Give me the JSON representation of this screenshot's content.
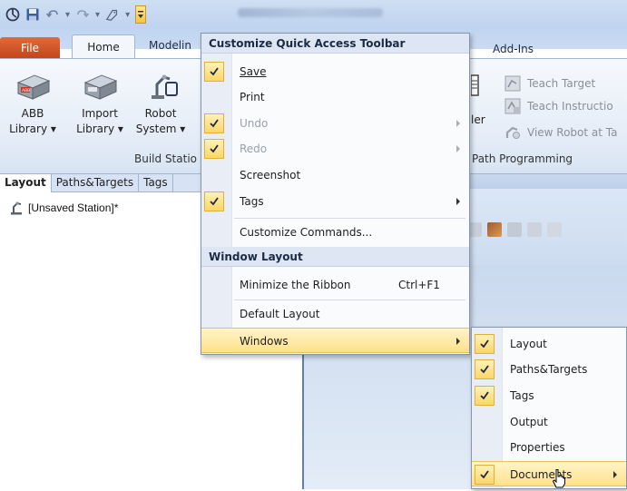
{
  "ribbon": {
    "tabs": {
      "file": "File",
      "home": "Home",
      "modeling": "Modelin",
      "addins": "Add-Ins"
    },
    "buttons": [
      {
        "line1": "ABB",
        "line2": "Library ▾"
      },
      {
        "line1": "Import",
        "line2": "Library ▾"
      },
      {
        "line1": "Robot",
        "line2": "System ▾"
      }
    ],
    "group_build": "Build Statio",
    "group_path": "Path Programming",
    "partial_label": "ler",
    "small_buttons": [
      "Teach Target",
      "Teach Instructio",
      "View Robot at Ta"
    ]
  },
  "panel": {
    "tabs": [
      "Layout",
      "Paths&Targets",
      "Tags"
    ],
    "tree_item": "[Unsaved Station]*"
  },
  "qat_menu": {
    "header1": "Customize Quick Access Toolbar",
    "header2": "Window Layout",
    "items": [
      {
        "label": "Save",
        "checked": true,
        "disabled": false,
        "submenu": false
      },
      {
        "label": "Print",
        "checked": false,
        "disabled": false,
        "submenu": false
      },
      {
        "label": "Undo",
        "checked": true,
        "disabled": true,
        "submenu": true
      },
      {
        "label": "Redo",
        "checked": true,
        "disabled": true,
        "submenu": true
      },
      {
        "label": "Screenshot",
        "checked": false,
        "disabled": false,
        "submenu": false
      },
      {
        "label": "Tags",
        "checked": true,
        "disabled": false,
        "submenu": true
      },
      {
        "label": "Customize Commands...",
        "checked": false,
        "disabled": false,
        "submenu": false
      }
    ],
    "layout_items": [
      {
        "label": "Minimize the Ribbon",
        "shortcut": "Ctrl+F1"
      },
      {
        "label": "Default Layout"
      },
      {
        "label": "Windows",
        "submenu": true,
        "highlighted": true
      }
    ]
  },
  "windows_menu": {
    "items": [
      {
        "label": "Layout",
        "checked": true
      },
      {
        "label": "Paths&Targets",
        "checked": true
      },
      {
        "label": "Tags",
        "checked": true
      },
      {
        "label": "Output",
        "checked": false
      },
      {
        "label": "Properties",
        "checked": false
      },
      {
        "label": "Documents",
        "checked": true,
        "submenu": true,
        "highlighted": true
      }
    ]
  },
  "colors": {
    "accent_file": "#d0532a",
    "highlight": "#fde08a",
    "check_bg": "#fcd667"
  }
}
